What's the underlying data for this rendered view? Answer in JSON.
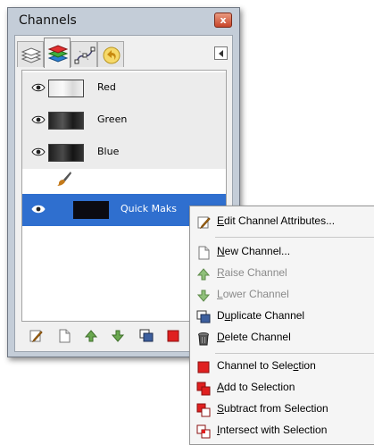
{
  "window": {
    "title": "Channels",
    "close_glyph": "x",
    "tabs": [
      {
        "name": "layers-tab",
        "icon": "layers-icon",
        "active": false
      },
      {
        "name": "channels-tab",
        "icon": "channels-icon",
        "active": true
      },
      {
        "name": "paths-tab",
        "icon": "paths-icon",
        "active": false
      },
      {
        "name": "undo-history-tab",
        "icon": "undo-icon",
        "active": false
      }
    ]
  },
  "channels": [
    {
      "label": "Red",
      "visible": true
    },
    {
      "label": "Green",
      "visible": true
    },
    {
      "label": "Blue",
      "visible": true
    }
  ],
  "quick_mask": {
    "label": "Quick Maks",
    "selected": true
  },
  "bottom_bar": {
    "buttons": [
      "edit-icon",
      "new-channel-icon",
      "raise-icon",
      "lower-icon",
      "duplicate-icon",
      "to-selection-icon"
    ]
  },
  "context_menu": {
    "items": [
      {
        "pre": "",
        "key": "E",
        "post": "dit Channel Attributes...",
        "icon": "edit-icon",
        "enabled": true
      },
      {
        "pre": "",
        "key": "N",
        "post": "ew Channel...",
        "icon": "new-channel-icon",
        "enabled": true
      },
      {
        "pre": "",
        "key": "R",
        "post": "aise Channel",
        "icon": "raise-icon",
        "enabled": false
      },
      {
        "pre": "",
        "key": "L",
        "post": "ower Channel",
        "icon": "lower-icon",
        "enabled": false
      },
      {
        "pre": "D",
        "key": "u",
        "post": "plicate Channel",
        "icon": "duplicate-icon",
        "enabled": true
      },
      {
        "pre": "",
        "key": "D",
        "post": "elete Channel",
        "icon": "delete-icon",
        "enabled": true
      },
      {
        "pre": "Channel to Sele",
        "key": "c",
        "post": "tion",
        "icon": "to-selection-icon",
        "enabled": true
      },
      {
        "pre": "",
        "key": "A",
        "post": "dd to Selection",
        "icon": "add-selection-icon",
        "enabled": true
      },
      {
        "pre": "",
        "key": "S",
        "post": "ubtract from Selection",
        "icon": "subtract-selection-icon",
        "enabled": true
      },
      {
        "pre": "",
        "key": "I",
        "post": "ntersect with Selection",
        "icon": "intersect-selection-icon",
        "enabled": true
      }
    ]
  },
  "colors": {
    "selection": "#2f6fcf",
    "window_frame": "#c4cdd8",
    "close_button": "#c8452a",
    "raise_lower_arrow": "#6aa84f",
    "selection_red": "#e02020"
  }
}
